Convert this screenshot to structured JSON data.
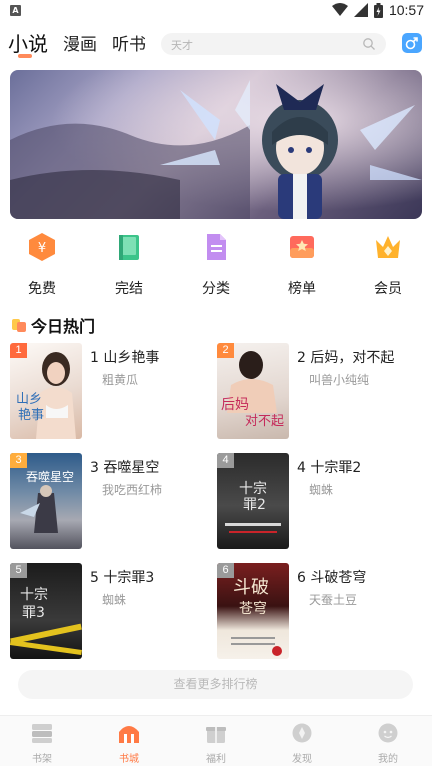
{
  "status_bar": {
    "time": "10:57",
    "left_icon": "A"
  },
  "top_nav": {
    "tabs": [
      {
        "label": "小说",
        "active": true
      },
      {
        "label": "漫画",
        "active": false
      },
      {
        "label": "听书",
        "active": false
      }
    ],
    "search_placeholder": "天才",
    "gender_icon": "male-icon"
  },
  "categories": [
    {
      "label": "免费",
      "icon": "coin-icon",
      "color": "#ff8a3d"
    },
    {
      "label": "完结",
      "icon": "book-icon",
      "color": "#3cc48a"
    },
    {
      "label": "分类",
      "icon": "document-icon",
      "color": "#b27ae6"
    },
    {
      "label": "榜单",
      "icon": "ranking-icon",
      "color": "#ff6a5c"
    },
    {
      "label": "会员",
      "icon": "crown-icon",
      "color": "#ffb22c"
    }
  ],
  "hot_section": {
    "title": "今日热门"
  },
  "books": [
    {
      "rank": "1",
      "title": "1 山乡艳事",
      "author": "粗黄瓜",
      "badge_color": "#ff6a3d"
    },
    {
      "rank": "2",
      "title": "2 后妈，对不起",
      "author": "叫兽小纯纯",
      "badge_color": "#ff8a3d"
    },
    {
      "rank": "3",
      "title": "3 吞噬星空",
      "author": "我吃西红柿",
      "badge_color": "#ffad3d"
    },
    {
      "rank": "4",
      "title": "4 十宗罪2",
      "author": "蜘蛛",
      "badge_color": "#9a9a9a"
    },
    {
      "rank": "5",
      "title": "5 十宗罪3",
      "author": "蜘蛛",
      "badge_color": "#9a9a9a"
    },
    {
      "rank": "6",
      "title": "6 斗破苍穹",
      "author": "天蚕土豆",
      "badge_color": "#9a9a9a"
    }
  ],
  "more_button": {
    "label": "查看更多排行榜"
  },
  "bottom_nav": [
    {
      "label": "书架",
      "icon": "bookshelf-icon",
      "active": false
    },
    {
      "label": "书城",
      "icon": "bookstore-icon",
      "active": true
    },
    {
      "label": "福利",
      "icon": "gift-icon",
      "active": false
    },
    {
      "label": "发现",
      "icon": "discover-icon",
      "active": false
    },
    {
      "label": "我的",
      "icon": "profile-icon",
      "active": false
    }
  ]
}
